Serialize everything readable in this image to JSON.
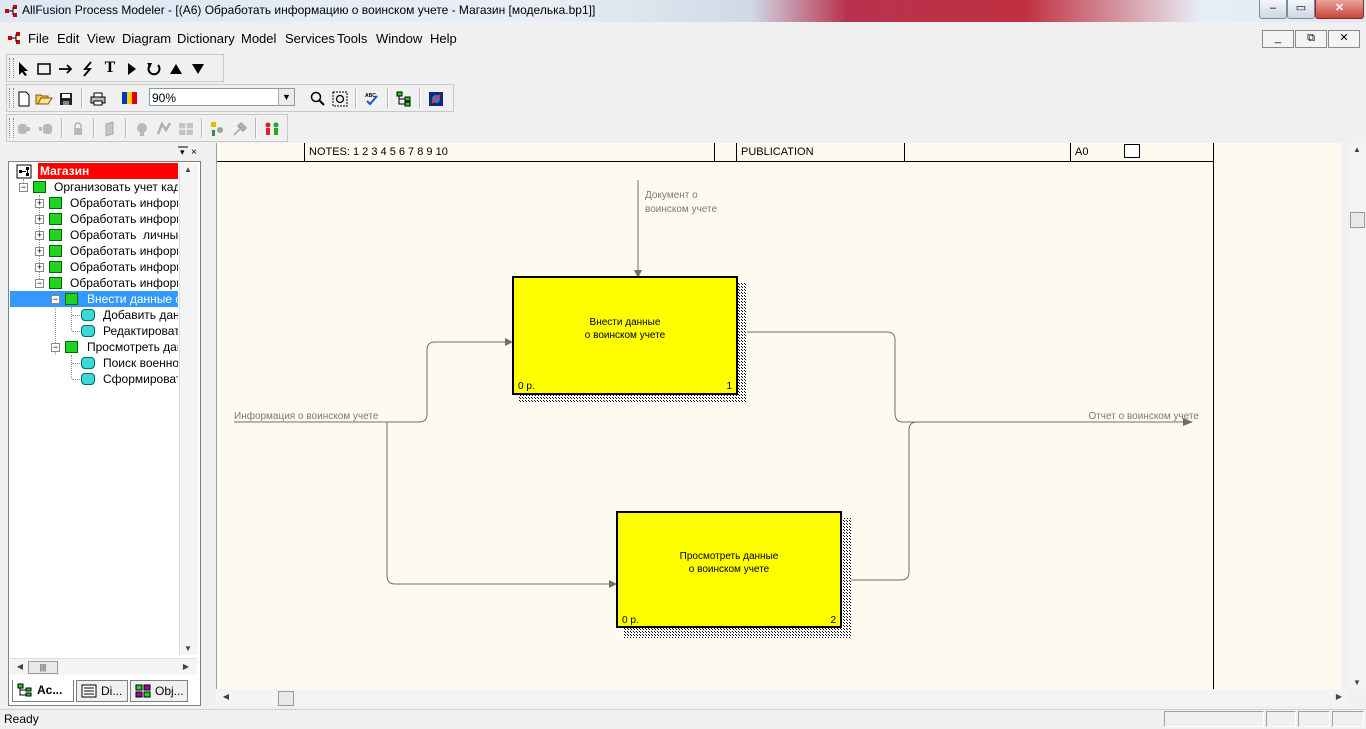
{
  "window": {
    "title": "AllFusion Process Modeler - [(A6) Обработать информацию о воинском учете - Магазин  [моделька.bp1]]",
    "min_label": "–",
    "restore_label": "▭",
    "close_label": "✕"
  },
  "menu": {
    "items": [
      {
        "label": "File"
      },
      {
        "label": "Edit"
      },
      {
        "label": "View"
      },
      {
        "label": "Diagram"
      },
      {
        "label": "Dictionary"
      },
      {
        "label": "Model"
      },
      {
        "label": "Services"
      },
      {
        "label": "Tools"
      },
      {
        "label": "Window"
      },
      {
        "label": "Help"
      }
    ],
    "mdi_min": "_",
    "mdi_restore": "⧉",
    "mdi_close": "✕"
  },
  "toolbar": {
    "zoom_value": "90%",
    "text_tool_label": "T"
  },
  "tree": {
    "root": "Магазин",
    "items": [
      {
        "label": "Организовать учет кадр",
        "icon": "green-box-icon"
      },
      {
        "label": "Обработать информа",
        "icon": "green-box-icon"
      },
      {
        "label": "Обработать информа",
        "icon": "green-box-icon"
      },
      {
        "label": "Обработать  личные",
        "icon": "green-box-icon"
      },
      {
        "label": "Обработать информа",
        "icon": "green-box-icon"
      },
      {
        "label": "Обработать информа",
        "icon": "green-box-icon"
      },
      {
        "label": "Обработать информа",
        "icon": "green-box-icon"
      },
      {
        "label": "Внести данные о в",
        "icon": "green-box-icon"
      },
      {
        "label": "Добавить данн",
        "icon": "cyan-box-icon"
      },
      {
        "label": "Редактировать",
        "icon": "cyan-box-icon"
      },
      {
        "label": "Просмотреть данн",
        "icon": "green-box-icon"
      },
      {
        "label": "Поиск военнос",
        "icon": "cyan-box-icon"
      },
      {
        "label": "Сформировать",
        "icon": "cyan-box-icon"
      }
    ],
    "h_scroll_grip": "|||"
  },
  "tabs": [
    {
      "label": "Ac..."
    },
    {
      "label": "Di..."
    },
    {
      "label": "Obj..."
    }
  ],
  "frame": {
    "notes": "NOTES:  1  2  3  4  5  6  7  8  9  10",
    "publication": "PUBLICATION",
    "node": "A0"
  },
  "diagram": {
    "box1": {
      "line1": "Внести данные",
      "line2": "о воинском учете",
      "cost": "0 р.",
      "number": "1"
    },
    "box2": {
      "line1": "Просмотреть данные",
      "line2": "о воинском учете",
      "cost": "0 р.",
      "number": "2"
    },
    "arrow_control_line1": "Документ о",
    "arrow_control_line2": "воинском учете",
    "arrow_input": "Информация о воинском учете",
    "arrow_output": "Отчет о воинском учете"
  },
  "status": {
    "text": "Ready"
  },
  "colors": {
    "activity_box": "#ffff00",
    "canvas_bg": "#fdfaf0",
    "tree_root_bg": "#ff0000",
    "tree_selected_bg": "#3399ff"
  }
}
